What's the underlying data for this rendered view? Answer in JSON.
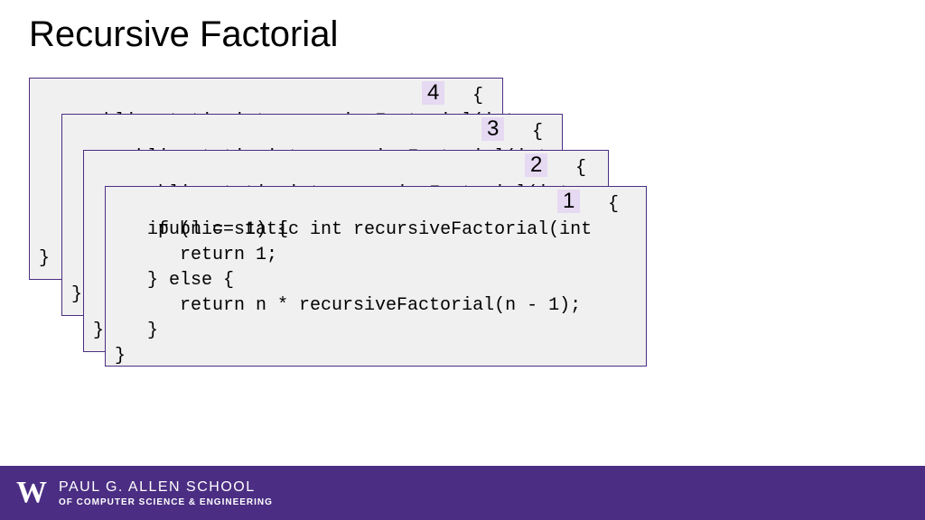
{
  "title": "Recursive Factorial",
  "code": {
    "signature_prefix": "public static int recursiveFactorial(int ",
    "signature_suffix": " {",
    "closing_brace": "}",
    "body_lines": "   if (n == 1) {\n      return 1;\n   } else {\n      return n * recursiveFactorial(n - 1);\n   }\n}"
  },
  "frames": [
    {
      "n": "4"
    },
    {
      "n": "3"
    },
    {
      "n": "2"
    },
    {
      "n": "1"
    }
  ],
  "footer": {
    "logo_letter": "W",
    "line1": "PAUL G. ALLEN SCHOOL",
    "line2": "OF COMPUTER SCIENCE & ENGINEERING"
  },
  "colors": {
    "uw_purple": "#4b2e83",
    "badge_bg": "#e6d9f2",
    "frame_bg": "#f0f0f0"
  }
}
